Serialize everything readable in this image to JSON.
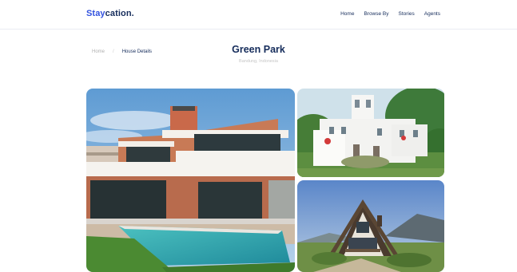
{
  "brand": {
    "prefix": "Stay",
    "suffix": "cation."
  },
  "nav": [
    "Home",
    "Browse By",
    "Stories",
    "Agents"
  ],
  "breadcrumb": {
    "home": "Home",
    "separator": "/",
    "current": "House Details"
  },
  "property": {
    "title": "Green Park",
    "location": "Bandung, Indonesia"
  },
  "colors": {
    "brand_navy": "#152c5b",
    "brand_blue": "#3252df"
  },
  "gallery_icons": [
    "modern-villa-photo",
    "white-chateau-photo",
    "wooden-chalet-photo"
  ]
}
